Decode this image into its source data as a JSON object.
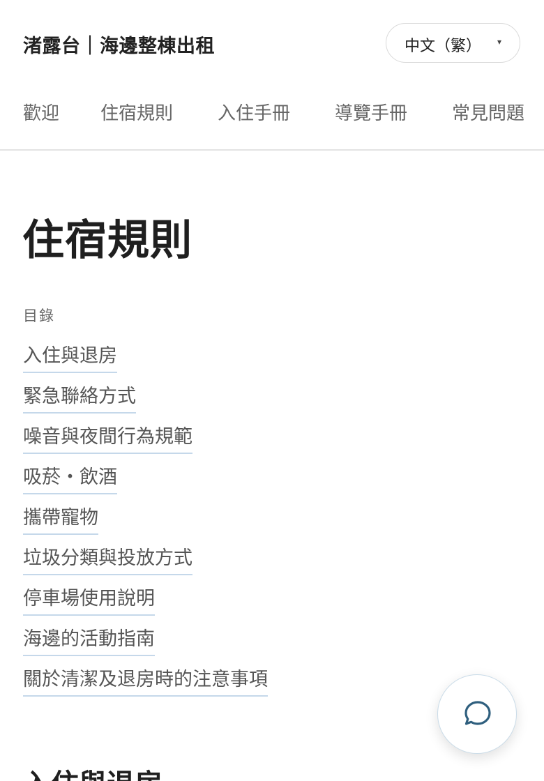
{
  "header": {
    "site_title": "渚露台｜海邊整棟出租",
    "language": {
      "selected": "中文（繁）",
      "caret": "▾"
    }
  },
  "nav": {
    "items": [
      {
        "label": "歡迎"
      },
      {
        "label": "住宿規則"
      },
      {
        "label": "入住手冊"
      },
      {
        "label": "導覽手冊"
      },
      {
        "label": "常見問題"
      }
    ]
  },
  "main": {
    "title": "住宿規則",
    "toc": {
      "heading": "目錄",
      "items": [
        {
          "label": "入住與退房"
        },
        {
          "label": "緊急聯絡方式"
        },
        {
          "label": "噪音與夜間行為規範"
        },
        {
          "label": "吸菸・飲酒"
        },
        {
          "label": "攜帶寵物"
        },
        {
          "label": "垃圾分類與投放方式"
        },
        {
          "label": "停車場使用說明"
        },
        {
          "label": "海邊的活動指南"
        },
        {
          "label": "關於清潔及退房時的注意事項"
        }
      ]
    },
    "first_section_heading": "入住與退房"
  },
  "chat": {
    "icon": "chat-bubble-icon",
    "icon_color": "#2f5f7e"
  },
  "colors": {
    "link_underline": "#c5d8ea",
    "nav_text": "#666666",
    "divider": "#e3e3e3"
  }
}
